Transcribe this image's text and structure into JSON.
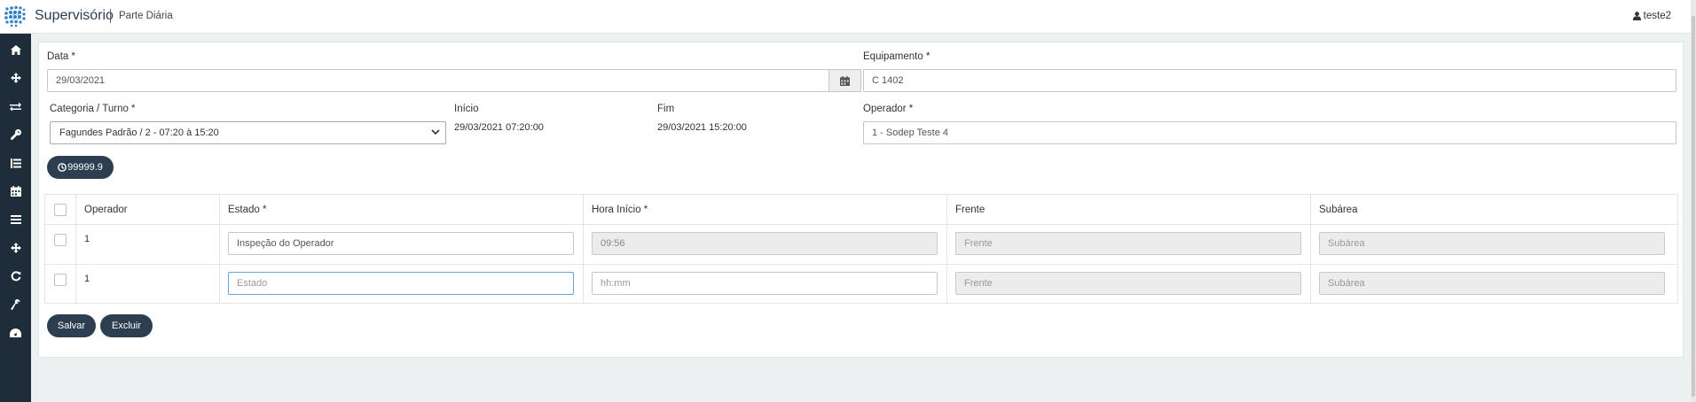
{
  "header": {
    "app_title": "Supervisório",
    "page_subtitle": "Parte Diária",
    "user": "teste2"
  },
  "sidebar": {
    "items": [
      {
        "name": "home",
        "icon": "home-icon"
      },
      {
        "name": "move",
        "icon": "move-icon"
      },
      {
        "name": "exchange",
        "icon": "exchange-icon"
      },
      {
        "name": "wrench",
        "icon": "wrench-icon"
      },
      {
        "name": "list",
        "icon": "list-icon"
      },
      {
        "name": "calendar",
        "icon": "calendar-icon"
      },
      {
        "name": "menu",
        "icon": "menu-icon"
      },
      {
        "name": "move-2",
        "icon": "move-icon"
      },
      {
        "name": "refresh",
        "icon": "refresh-icon"
      },
      {
        "name": "tool",
        "icon": "tool-icon"
      },
      {
        "name": "dashboard",
        "icon": "dashboard-icon"
      }
    ]
  },
  "form": {
    "data_label": "Data *",
    "data_value": "29/03/2021",
    "equipamento_label": "Equipamento *",
    "equipamento_value": "C 1402",
    "categoria_label": "Categoria / Turno *",
    "categoria_value": "Fagundes Padrão / 2 - 07:20 à 15:20",
    "inicio_label": "Início",
    "inicio_value": "29/03/2021 07:20:00",
    "fim_label": "Fim",
    "fim_value": "29/03/2021 15:20:00",
    "operador_label": "Operador *",
    "operador_value": "1 - Sodep Teste 4",
    "hourmeter_value": "99999.9"
  },
  "table": {
    "headers": {
      "operador": "Operador",
      "estado": "Estado *",
      "hora_inicio": "Hora Início *",
      "frente": "Frente",
      "subarea": "Subárea"
    },
    "rows": [
      {
        "operador": "1",
        "estado_value": "Inspeção do Operador",
        "estado_placeholder": "Estado",
        "hora_value": "09:56",
        "hora_placeholder": "hh:mm",
        "frente_placeholder": "Frente",
        "subarea_placeholder": "Subárea"
      },
      {
        "operador": "1",
        "estado_value": "",
        "estado_placeholder": "Estado",
        "hora_value": "",
        "hora_placeholder": "hh:mm",
        "frente_placeholder": "Frente",
        "subarea_placeholder": "Subárea"
      }
    ]
  },
  "actions": {
    "save_label": "Salvar",
    "delete_label": "Excluir"
  },
  "colors": {
    "sidebar": "#1f2d3a",
    "button": "#2c3e50",
    "focus": "#66a4d9"
  }
}
